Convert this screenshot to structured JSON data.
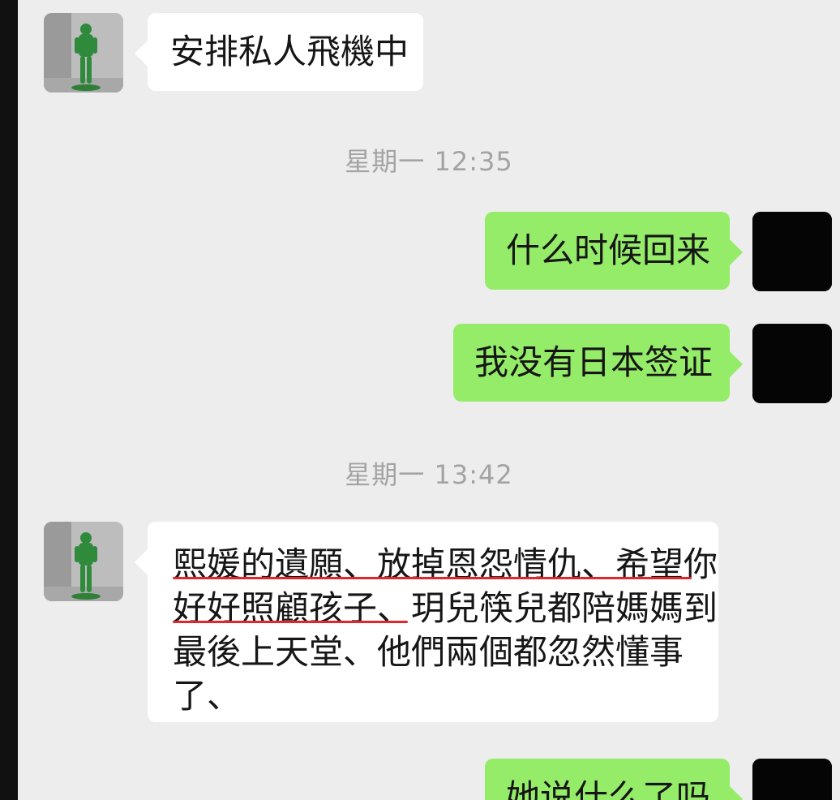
{
  "messages": [
    {
      "id": "m1",
      "side": "left",
      "text": "安排私人飛機中"
    },
    {
      "id": "t1",
      "type": "time",
      "text": "星期一 12:35"
    },
    {
      "id": "m2",
      "side": "right",
      "text": "什么时候回来"
    },
    {
      "id": "m3",
      "side": "right",
      "text": "我没有日本签证"
    },
    {
      "id": "t2",
      "type": "time",
      "text": "星期一 13:42"
    },
    {
      "id": "m4",
      "side": "left",
      "lines": [
        "熙媛的遺願、放掉恩怨情仇、希望你",
        "好好照顧孩子、玥兒筷兒都陪媽媽到",
        "最後上天堂、他們兩個都忽然懂事",
        "了、"
      ]
    },
    {
      "id": "m5",
      "side": "right",
      "text": "她说什么了吗"
    }
  ],
  "colors": {
    "chat_bg": "#ededed",
    "outgoing_bubble": "#95ec69",
    "incoming_bubble": "#ffffff",
    "timestamp_text": "#a3a3a3",
    "annotation_underline": "#e3262a"
  },
  "icons": {
    "contact_avatar": "green-figure-avatar-icon",
    "user_avatar": "black-avatar-icon"
  }
}
